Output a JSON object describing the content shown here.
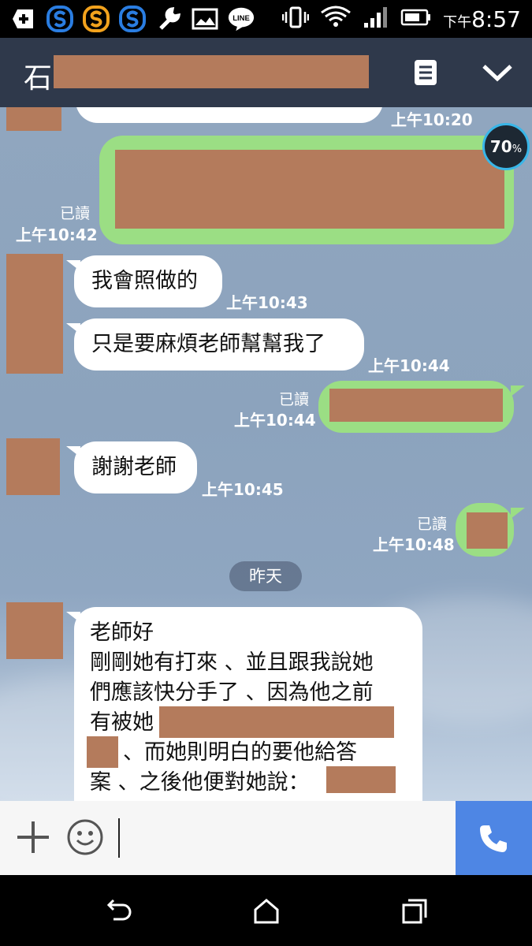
{
  "status_bar": {
    "time_prefix": "下午",
    "time": "8:57",
    "icons": [
      "add-icon",
      "s-app-icon-blue",
      "s-app-icon-orange",
      "s-app-icon-blue2",
      "wrench-icon",
      "image-icon",
      "line-icon"
    ],
    "line_label": "LINE"
  },
  "header": {
    "title_visible": "石",
    "menu_icon": "notes-icon",
    "collapse_icon": "chevron-down-icon"
  },
  "overlay": {
    "percent": "70",
    "percent_sign": "%"
  },
  "messages": [
    {
      "id": "m1",
      "direction": "in",
      "time": "上午10:20"
    },
    {
      "id": "m2",
      "direction": "out",
      "read": "已讀",
      "time": "上午10:42"
    },
    {
      "id": "m3",
      "direction": "in",
      "text": "我會照做的",
      "time": "上午10:43"
    },
    {
      "id": "m4",
      "direction": "in",
      "text": "只是要麻煩老師幫幫我了",
      "time": "上午10:44"
    },
    {
      "id": "m5",
      "direction": "out",
      "read": "已讀",
      "time": "上午10:44"
    },
    {
      "id": "m6",
      "direction": "in",
      "text": "謝謝老師",
      "time": "上午10:45"
    },
    {
      "id": "m7",
      "direction": "out",
      "read": "已讀",
      "time": "上午10:48"
    }
  ],
  "date_divider": "昨天",
  "long_message": {
    "lines": [
      "老師好",
      "剛剛她有打來 、並且跟我說她",
      "們應該快分手了 、因為他之前",
      "有被她",
      "、而她則明白的要他給答",
      "案 、之後他便對她說："
    ]
  },
  "input_bar": {
    "add_icon": "plus-icon",
    "sticker_icon": "smiley-icon",
    "call_icon": "phone-icon"
  },
  "colors": {
    "header_bg": "#2f394b",
    "outgoing_bubble": "#9bde84",
    "call_button": "#4e86e4",
    "redaction": "#b47b5c"
  }
}
